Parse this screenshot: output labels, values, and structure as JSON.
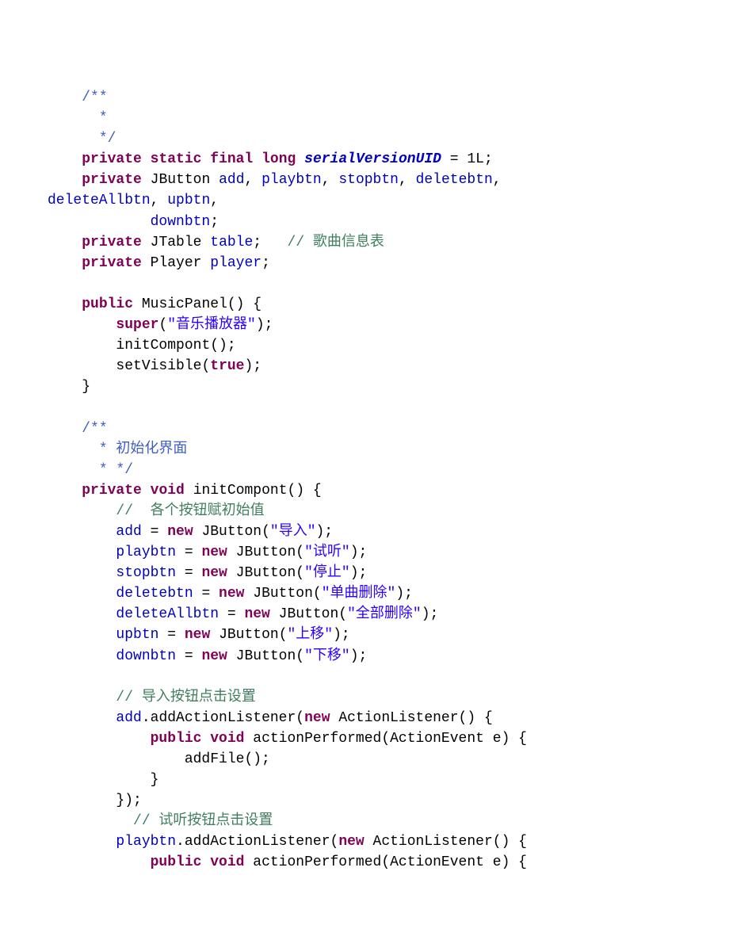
{
  "comments": {
    "jdoc1_l1": "/**",
    "jdoc1_l2": " *",
    "jdoc1_l3": " */",
    "line_songinfo": "// 歌曲信息表",
    "jdoc2_l1": "/**",
    "jdoc2_l2": " * 初始化界面",
    "jdoc2_l3": " * */",
    "btn_init": "//  各个按钮赋初始值",
    "import_click": "// 导入按钮点击设置",
    "play_click": "// 试听按钮点击设置"
  },
  "kw": {
    "private": "private",
    "static": "static",
    "final": "final",
    "long": "long",
    "public": "public",
    "super": "super",
    "true": "true",
    "void": "void",
    "new": "new"
  },
  "types": {
    "JButton": "JButton",
    "JTable": "JTable",
    "Player": "Player",
    "ActionListener": "ActionListener",
    "ActionEvent": "ActionEvent"
  },
  "fields": {
    "serialVersionUID": "serialVersionUID",
    "add": "add",
    "playbtn": "playbtn",
    "stopbtn": "stopbtn",
    "deletebtn": "deletebtn",
    "deleteAllbtn": "deleteAllbtn",
    "upbtn": "upbtn",
    "downbtn": "downbtn",
    "table": "table",
    "player": "player"
  },
  "methods": {
    "MusicPanel": "MusicPanel",
    "initCompont": "initCompont",
    "setVisible": "setVisible",
    "addActionListener": "addActionListener",
    "actionPerformed": "actionPerformed",
    "addFile": "addFile"
  },
  "strings": {
    "music_player": "\"音乐播放器\"",
    "import": "\"导入\"",
    "play": "\"试听\"",
    "stop": "\"停止\"",
    "delete_one": "\"单曲删除\"",
    "delete_all": "\"全部删除\"",
    "move_up": "\"上移\"",
    "move_down": "\"下移\""
  },
  "nums": {
    "one_l": "1L"
  },
  "punct": {
    "eq": " = ",
    "semi": ";",
    "comma_sp": ", ",
    "lparen": "(",
    "rparen": ")",
    "lbrace": "{",
    "rbrace": "}",
    "dot": ".",
    "sp": " ",
    "rparen_semi": ");",
    "rparen_sp_lbrace": ") {",
    "empty_parens_sp_lbrace": "() {",
    "rbrace_rparen_semi": "});"
  },
  "params": {
    "e": "e"
  },
  "indent": {
    "i1": "    ",
    "i2": "        ",
    "i3": "            ",
    "i4": "                ",
    "i15": "     ",
    "i16": "      "
  }
}
